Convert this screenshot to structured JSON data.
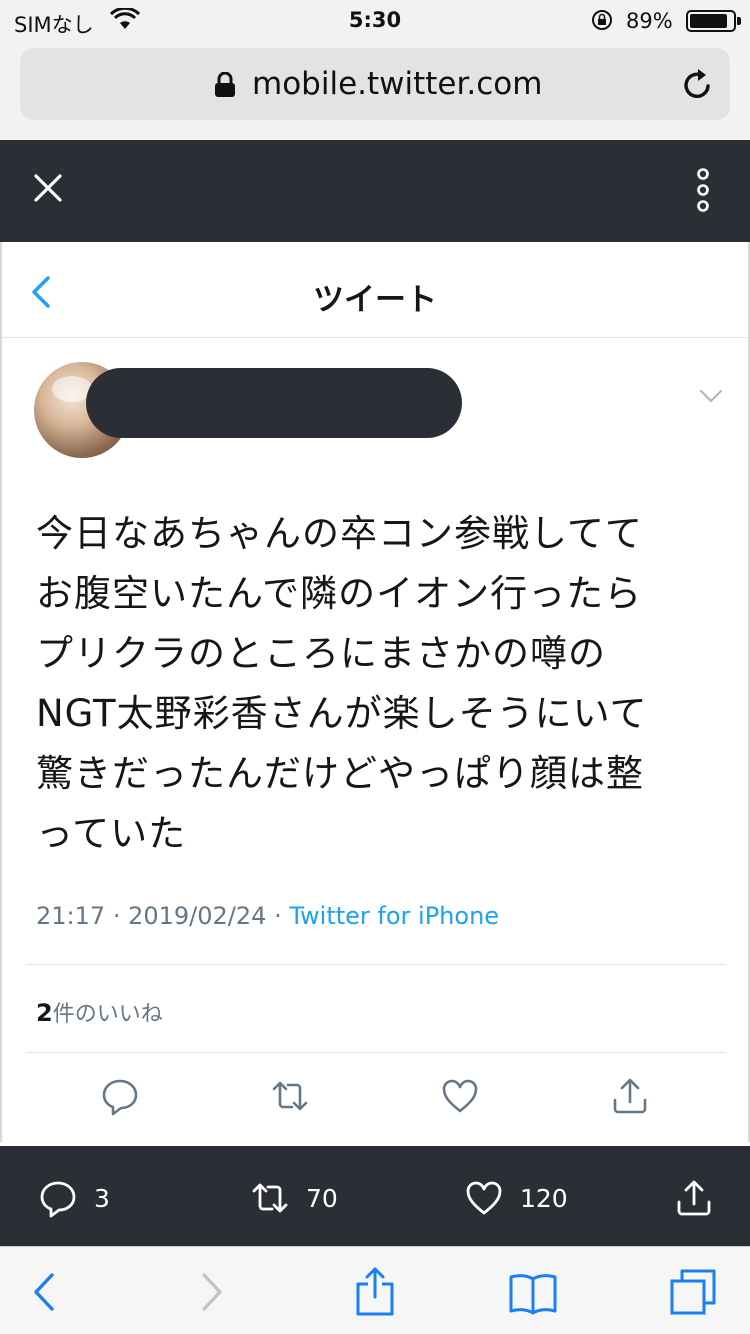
{
  "status_bar": {
    "carrier": "SIMなし",
    "time": "5:30",
    "battery_percent": "89%",
    "battery_level": 0.89
  },
  "browser": {
    "url": "mobile.twitter.com"
  },
  "tweet_view": {
    "header_title": "ツイート",
    "text_lines": [
      "今日なあちゃんの卒コン参戦してて",
      "お腹空いたんで隣のイオン行ったら",
      "プリクラのところにまさかの噂の",
      "NGT太野彩香さんが楽しそうにいて",
      "驚きだったんだけどやっぱり顔は整",
      "っていた"
    ],
    "time": "21:17",
    "date": "2019/02/24",
    "separator": "·",
    "source": "Twitter for iPhone",
    "likes_count": "2",
    "likes_label": "件のいいね"
  },
  "engagement": {
    "replies": "3",
    "retweets": "70",
    "likes": "120"
  },
  "icons": {
    "accent": "#1da1f2",
    "dark_bar": "#2b2f35",
    "safari_blue": "#1a7ff5"
  }
}
